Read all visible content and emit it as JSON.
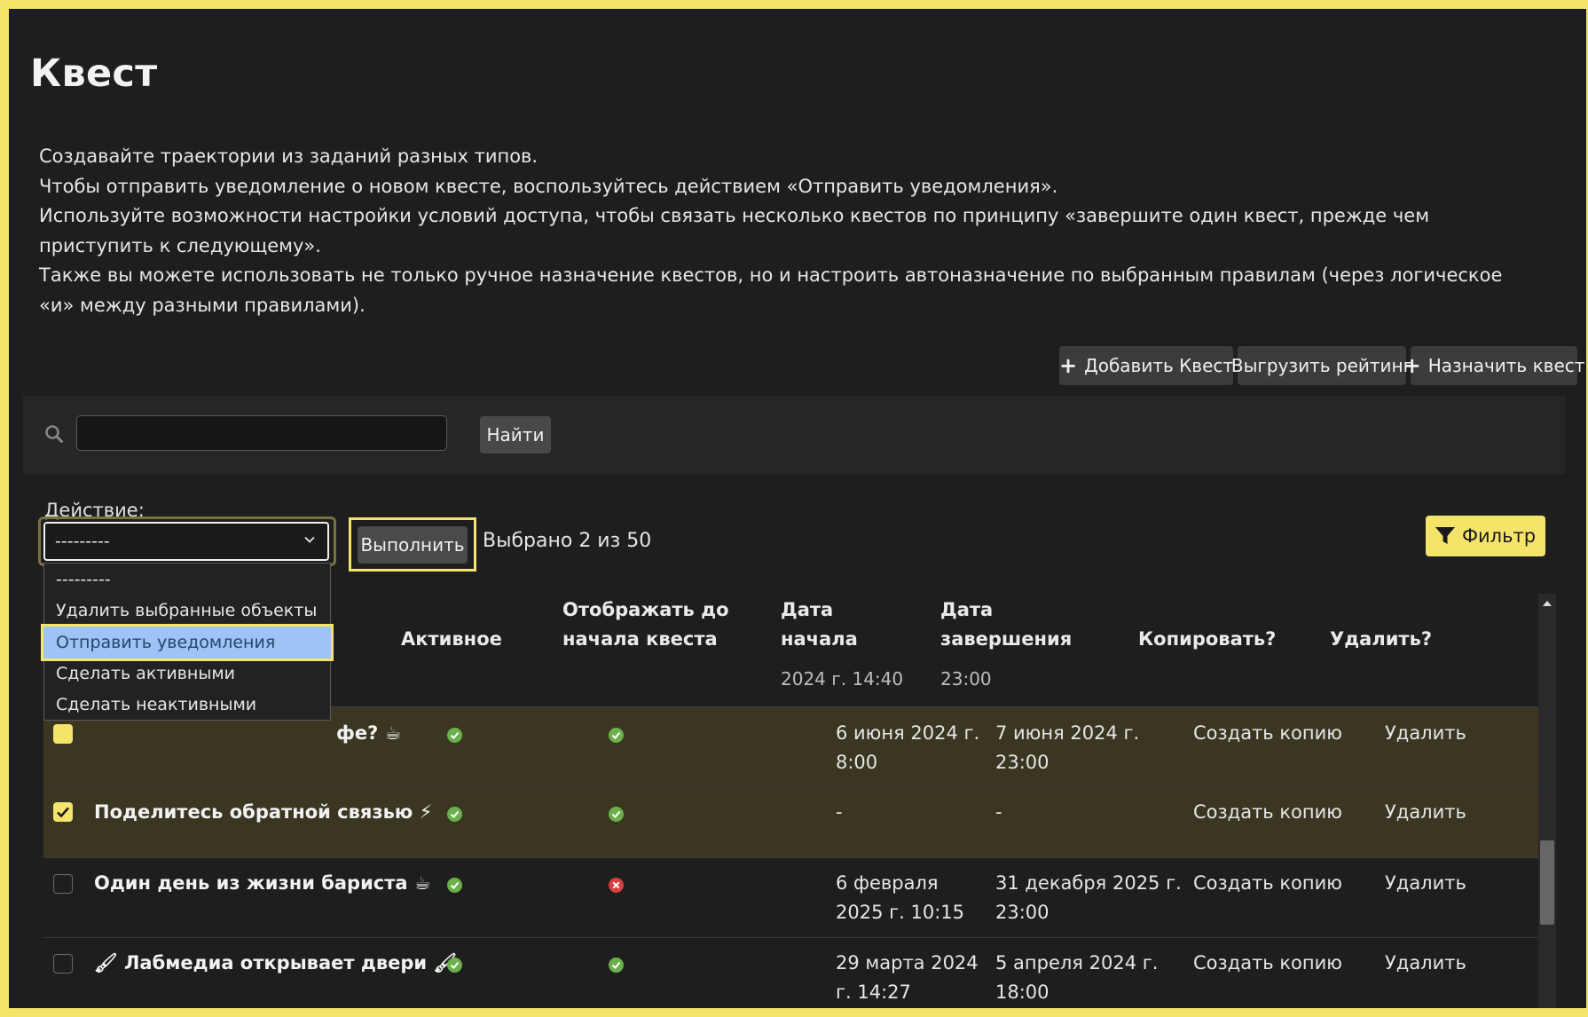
{
  "page": {
    "title": "Квест"
  },
  "description": [
    "Создавайте траектории из заданий разных типов.",
    "Чтобы отправить уведомление о новом квесте, воспользуйтесь действием «Отправить уведомления».",
    "Используйте возможности настройки условий доступа, чтобы связать несколько квестов по принципу «завершите один квест, прежде чем приступить к следующему».",
    "Также вы можете использовать не только ручное назначение квестов, но и настроить автоназначение по выбранным правилам (через логическое «и» между разными правилами)."
  ],
  "toolbar": {
    "add_quest": "Добавить Квест",
    "export_rating": "Выгрузить рейтинг",
    "assign_quest": "Назначить квест"
  },
  "search": {
    "button": "Найти",
    "placeholder": ""
  },
  "action": {
    "label": "Действие:",
    "selected": "---------",
    "options": [
      "---------",
      "Удалить выбранные объекты",
      "Отправить уведомления",
      "Сделать активными",
      "Сделать неактивными"
    ],
    "highlighted_index": 2,
    "run_button": "Выполнить",
    "selected_count": "Выбрано 2 из 50"
  },
  "filter": {
    "label": "Фильтр"
  },
  "table": {
    "headers": {
      "active": "Активное",
      "show_before_line1": "Отображать до",
      "show_before_line2": "начала квеста",
      "start_line1": "Дата",
      "start_line2": "начала",
      "end_line1": "Дата",
      "end_line2": "завершения",
      "copy": "Копировать?",
      "delete": "Удалить?"
    },
    "ghost_row": {
      "start": "2024 г. 14:40",
      "end": "23:00"
    },
    "rows": [
      {
        "name": "фе? ☕",
        "checked": true,
        "active": true,
        "show_before": true,
        "start_l1": "6 июня 2024 г.",
        "start_l2": "8:00",
        "end_l1": "7 июня 2024 г.",
        "end_l2": "23:00",
        "copy": "Создать копию",
        "delete": "Удалить"
      },
      {
        "name": "Поделитесь обратной связью ⚡",
        "checked": true,
        "active": true,
        "show_before": true,
        "start_l1": "-",
        "start_l2": "",
        "end_l1": "-",
        "end_l2": "",
        "copy": "Создать копию",
        "delete": "Удалить"
      },
      {
        "name": "Один день из жизни бариста ☕",
        "checked": false,
        "active": true,
        "show_before": false,
        "start_l1": "6 февраля",
        "start_l2": "2025 г. 10:15",
        "end_l1": "31 декабря 2025 г.",
        "end_l2": "23:00",
        "copy": "Создать копию",
        "delete": "Удалить"
      },
      {
        "name": "🖌 Лабмедиа открывает двери 🖌",
        "checked": false,
        "active": true,
        "show_before": true,
        "start_l1": "29 марта 2024",
        "start_l2": "г. 14:27",
        "end_l1": "5 апреля 2024 г.",
        "end_l2": "18:00",
        "copy": "Создать копию",
        "delete": "Удалить"
      }
    ]
  },
  "colors": {
    "accent": "#f5e46a",
    "ok": "#6ab04c",
    "error": "#d64040",
    "highlight": "#9ec3f5"
  },
  "icons": [
    "search-icon",
    "plus-icon",
    "chevron-down-icon",
    "filter-icon",
    "check-circle-icon",
    "x-circle-icon",
    "checkbox-icon"
  ]
}
